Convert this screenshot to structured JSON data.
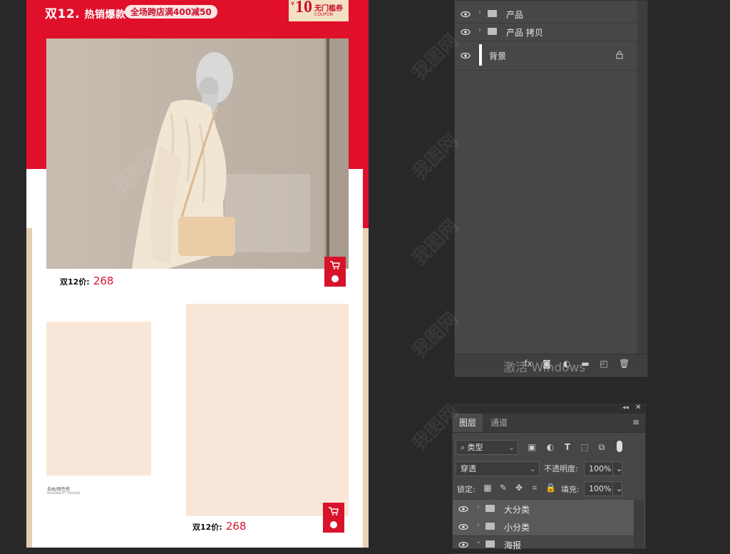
{
  "banner": {
    "title": "双12.",
    "subtitle": "热销爆款",
    "promo": "全场跨店满400减50",
    "coupon": {
      "currency": "¥",
      "amount": "10",
      "text": "无门槛券",
      "en": "COUPON"
    }
  },
  "products": [
    {
      "price_label": "双12价:",
      "price": "268"
    },
    {
      "price_label": "双12价:",
      "price": "268"
    }
  ],
  "caption": {
    "line1": "自由/随性搭",
    "line2": "PERSONALITY FASHION"
  },
  "layers_top": {
    "rows": [
      {
        "name": "产品",
        "type": "folder"
      },
      {
        "name": "产品 拷贝",
        "type": "folder"
      },
      {
        "name": "背景",
        "type": "background"
      }
    ],
    "activate_windows": "激活 Windows"
  },
  "layers_panel": {
    "tabs": [
      "图层",
      "通道"
    ],
    "filter_kind": "类型",
    "blend_mode": "穿透",
    "opacity_label": "不透明度:",
    "opacity_value": "100%",
    "lock_label": "锁定:",
    "fill_label": "填充:",
    "fill_value": "100%",
    "rows": [
      {
        "name": "大分类",
        "type": "folder"
      },
      {
        "name": "小分类",
        "type": "folder"
      },
      {
        "name": "海报",
        "type": "folder"
      }
    ]
  },
  "watermark": "我图网",
  "colors": {
    "brand_red": "#e0102a",
    "panel_bg": "#464646",
    "app_bg": "#282828",
    "beige": "#f8e7d8"
  }
}
